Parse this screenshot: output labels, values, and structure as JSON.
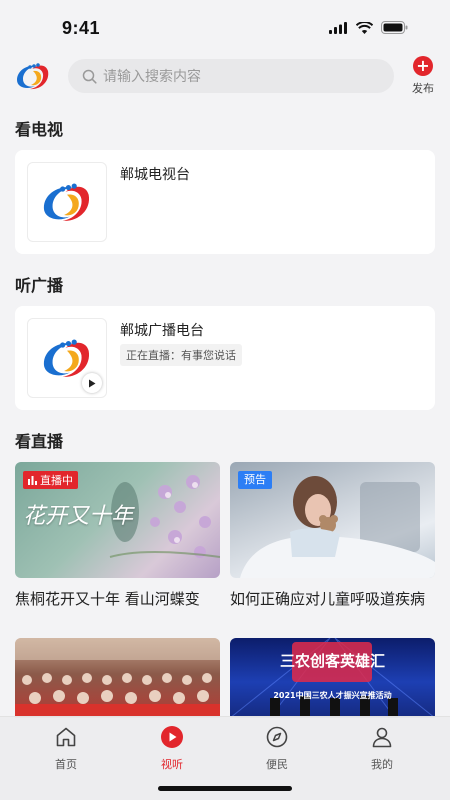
{
  "status": {
    "time": "9:41"
  },
  "header": {
    "search_placeholder": "请输入搜索内容",
    "publish_label": "发布"
  },
  "tv_section": {
    "title": "看电视",
    "station_name": "郸城电视台"
  },
  "radio_section": {
    "title": "听广播",
    "station_name": "郸城广播电台",
    "now_playing": "正在直播：有事您说话"
  },
  "live_section": {
    "title": "看直播",
    "items": [
      {
        "caption": "焦桐花开又十年 看山河蝶变",
        "badge": "直播中",
        "overlay_text": "花开又十年"
      },
      {
        "caption": "如何正确应对儿童呼吸道疾病",
        "badge": "预告"
      },
      {
        "caption": ""
      },
      {
        "caption": "",
        "overlay_title": "三农创客英雄汇",
        "overlay_text": "2021中国三农人才振兴宣推活动"
      }
    ]
  },
  "tabbar": {
    "items": [
      {
        "label": "首页",
        "icon": "home-icon"
      },
      {
        "label": "视听",
        "icon": "play-circle-icon",
        "active": true
      },
      {
        "label": "便民",
        "icon": "compass-icon"
      },
      {
        "label": "我的",
        "icon": "user-icon"
      }
    ]
  },
  "colors": {
    "accent": "#e2262c",
    "preview_badge": "#2c7ef5",
    "background": "#f3f3f5"
  }
}
